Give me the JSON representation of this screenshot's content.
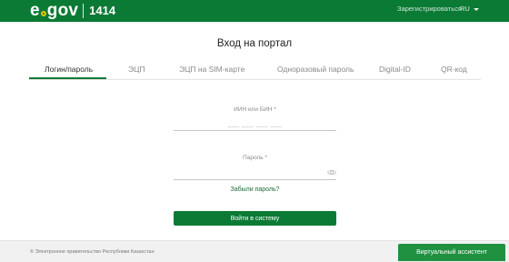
{
  "header": {
    "logo_left": "e",
    "logo_right": "gov",
    "logo_number": "1414",
    "register_link": "Зарегистрироваться",
    "language": "RU"
  },
  "page_title": "Вход на портал",
  "tabs": [
    {
      "label": "Логин/пароль",
      "active": true
    },
    {
      "label": "ЭЦП",
      "active": false
    },
    {
      "label": "ЭЦП на SIM-карте",
      "active": false
    },
    {
      "label": "Одноразовый пароль",
      "active": false
    },
    {
      "label": "Digital-ID",
      "active": false
    },
    {
      "label": "QR-код",
      "active": false
    }
  ],
  "form": {
    "iin_label": "ИИН или БИН *",
    "iin_placeholder": "___ ___ ___ ___",
    "password_label": "Пароль *",
    "password_placeholder": "",
    "forgot_password": "Забыли пароль?",
    "submit_label": "Войти в систему"
  },
  "footer": {
    "copyright": "© Электронное правительство Республики Казахстан",
    "assistant_button": "Виртуальный ассистент"
  },
  "colors": {
    "brand_green": "#0b7a35",
    "accent_yellow": "#f2c400",
    "assistant_green": "#1f9140"
  }
}
